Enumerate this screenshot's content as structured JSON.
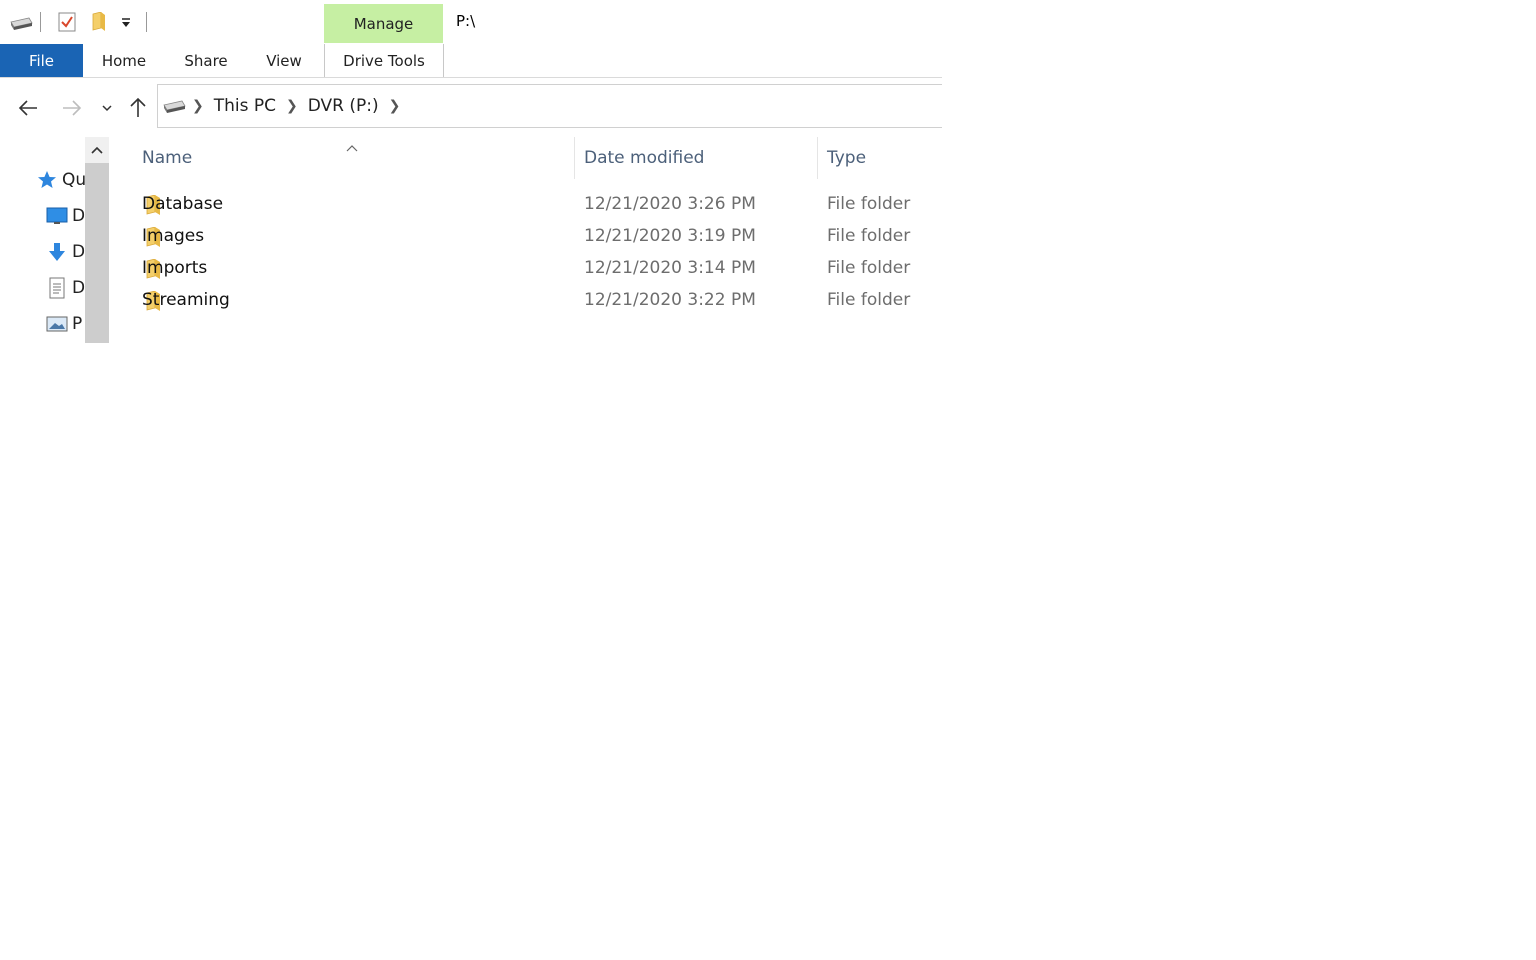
{
  "title_bar": {
    "path": "P:\\",
    "contextual_tab": "Manage"
  },
  "ribbon": {
    "tabs": [
      {
        "label": "File"
      },
      {
        "label": "Home"
      },
      {
        "label": "Share"
      },
      {
        "label": "View"
      },
      {
        "label": "Drive Tools"
      }
    ]
  },
  "address_bar": {
    "crumbs": [
      "This PC",
      "DVR (P:)"
    ]
  },
  "nav_pane": {
    "items": [
      {
        "label": "Qu",
        "icon": "star-icon"
      },
      {
        "label": "D",
        "icon": "desktop-icon"
      },
      {
        "label": "D",
        "icon": "downloads-icon"
      },
      {
        "label": "D",
        "icon": "documents-icon"
      },
      {
        "label": "P",
        "icon": "pictures-icon"
      }
    ]
  },
  "file_list": {
    "columns": {
      "name": "Name",
      "date": "Date modified",
      "type": "Type"
    },
    "rows": [
      {
        "name": "Database",
        "date": "12/21/2020 3:26 PM",
        "type": "File folder"
      },
      {
        "name": "Images",
        "date": "12/21/2020 3:19 PM",
        "type": "File folder"
      },
      {
        "name": "Imports",
        "date": "12/21/2020 3:14 PM",
        "type": "File folder"
      },
      {
        "name": "Streaming",
        "date": "12/21/2020 3:22 PM",
        "type": "File folder"
      }
    ]
  },
  "colors": {
    "file_tab": "#1a64b4",
    "manage_tab": "#c6efa3",
    "folder": "#f4cf6a"
  }
}
